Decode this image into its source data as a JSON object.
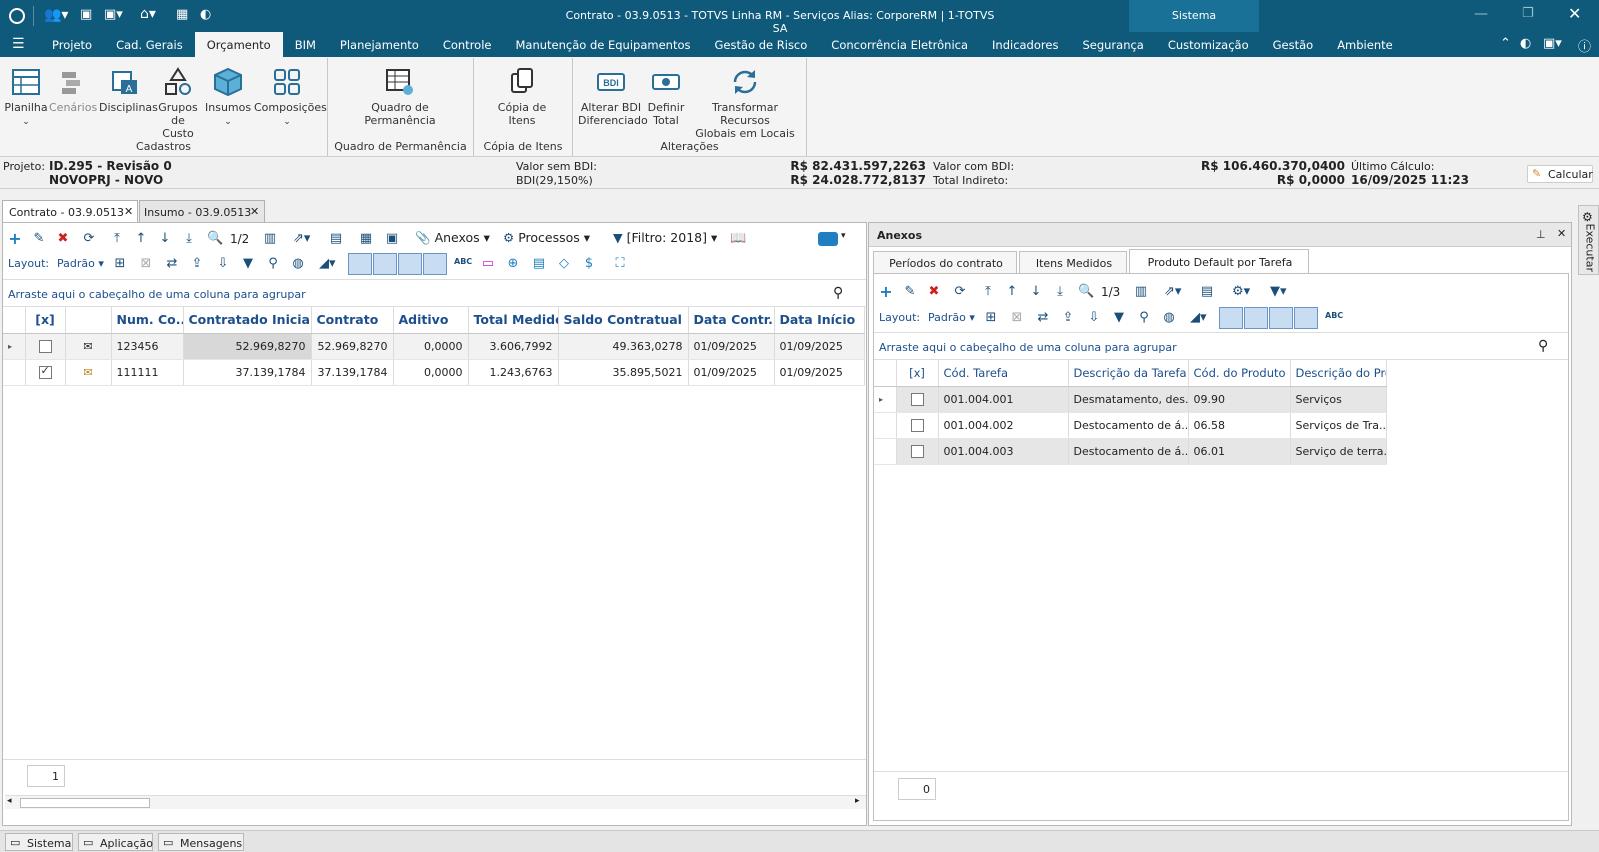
{
  "window": {
    "title": "Contrato - 03.9.0513 - TOTVS Linha RM - Serviços  Alias: CorporeRM | 1-TOTVS SA",
    "sistema": "Sistema"
  },
  "menu": {
    "items": [
      "Projeto",
      "Cad. Gerais",
      "Orçamento",
      "BIM",
      "Planejamento",
      "Controle",
      "Manutenção de Equipamentos",
      "Gestão de Risco",
      "Concorrência Eletrônica",
      "Indicadores",
      "Segurança",
      "Customização",
      "Gestão",
      "Ambiente"
    ],
    "active": "Orçamento"
  },
  "ribbon": {
    "cadastros": {
      "label": "Cadastros",
      "planilha": "Planilha",
      "cenarios": "Cenários",
      "disciplinas": "Disciplinas",
      "grupos1": "Grupos",
      "grupos2": "de Custo",
      "insumos": "Insumos",
      "composicoes": "Composições"
    },
    "quadro": {
      "label": "Quadro de Permanência",
      "btn1": "Quadro de",
      "btn2": "Permanência"
    },
    "copia": {
      "label": "Cópia de Itens",
      "btn1": "Cópia de",
      "btn2": "Itens"
    },
    "alteracoes": {
      "label": "Alterações",
      "bdi1": "Alterar BDI",
      "bdi2": "Diferenciado",
      "def1": "Definir",
      "def2": "Total",
      "trans1": "Transformar Recursos",
      "trans2": "Globais em Locais"
    }
  },
  "info": {
    "projeto_label": "Projeto:",
    "projeto": "ID.295 - Revisão 0",
    "projeto2": "NOVOPRJ - NOVO",
    "vsem_label": "Valor sem BDI:",
    "vsem": "R$ 82.431.597,2263",
    "bdi_label": "BDI(29,150%)",
    "bdi": "R$ 24.028.772,8137",
    "vcom_label": "Valor com BDI:",
    "vcom": "R$ 106.460.370,0400",
    "ti_label": "Total Indireto:",
    "ti": "R$ 0,0000",
    "uc_label": "Último Cálculo:",
    "uc": "16/09/2025 11:23",
    "calcular": "Calcular"
  },
  "doctabs": [
    {
      "label": "Contrato - 03.9.0513"
    },
    {
      "label": "Insumo - 03.9.0513"
    }
  ],
  "left": {
    "toolbar": {
      "page": "1/2",
      "anexos": "Anexos",
      "processos": "Processos",
      "filtro": "[Filtro: 2018]",
      "layout": "Layout:",
      "padrao": "Padrão"
    },
    "group_hint": "Arraste aqui o cabeçalho de uma coluna para agrupar",
    "columns": [
      "[x]",
      "",
      "Num. Co...",
      "Contratado Inicial",
      "Contrato",
      "Aditivo",
      "Total Medido",
      "Saldo Contratual",
      "Data Contr...",
      "Data Início"
    ],
    "rows": [
      {
        "num": "123456",
        "ci": "52.969,8270",
        "contrato": "52.969,8270",
        "aditivo": "0,0000",
        "medido": "3.606,7992",
        "saldo": "49.363,0278",
        "dc": "01/09/2025",
        "di": "01/09/2025",
        "checked": false
      },
      {
        "num": "111111",
        "ci": "37.139,1784",
        "contrato": "37.139,1784",
        "aditivo": "0,0000",
        "medido": "1.243,6763",
        "saldo": "35.895,5021",
        "dc": "01/09/2025",
        "di": "01/09/2025",
        "checked": true
      }
    ],
    "footer": "1"
  },
  "right": {
    "title": "Anexos",
    "tabs": [
      "Períodos do contrato",
      "Itens Medidos",
      "Produto Default por Tarefa"
    ],
    "toolbar": {
      "page": "1/3",
      "layout": "Layout:",
      "padrao": "Padrão"
    },
    "group_hint": "Arraste aqui o cabeçalho de uma coluna para agrupar",
    "columns": [
      "[x]",
      "Cód. Tarefa",
      "Descrição da Tarefa",
      "Cód. do Produto",
      "Descrição do Prod..."
    ],
    "rows": [
      {
        "cod": "001.004.001",
        "desc": "Desmatamento, des...",
        "prod": "09.90",
        "dprod": "Serviços"
      },
      {
        "cod": "001.004.002",
        "desc": "Destocamento de á...",
        "prod": "06.58",
        "dprod": "Serviços de Tra..."
      },
      {
        "cod": "001.004.003",
        "desc": "Destocamento de á...",
        "prod": "06.01",
        "dprod": "Serviço de terra..."
      }
    ],
    "footer": "0"
  },
  "side": {
    "executar": "Executar"
  },
  "status": {
    "sistema": "Sistema",
    "aplicacao": "Aplicação",
    "mensagens": "Mensagens"
  },
  "colors": {
    "titlebar": "#0f5a7a",
    "accent": "#1c4f8c"
  }
}
